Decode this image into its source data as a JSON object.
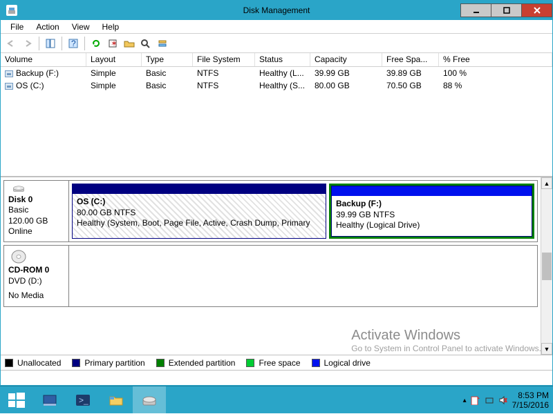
{
  "titlebar": {
    "title": "Disk Management"
  },
  "menu": {
    "file": "File",
    "action": "Action",
    "view": "View",
    "help": "Help"
  },
  "columns": {
    "volume": "Volume",
    "layout": "Layout",
    "type": "Type",
    "fs": "File System",
    "status": "Status",
    "capacity": "Capacity",
    "free": "Free Spa...",
    "pct": "% Free"
  },
  "volumes": [
    {
      "name": "Backup (F:)",
      "layout": "Simple",
      "type": "Basic",
      "fs": "NTFS",
      "status": "Healthy (L...",
      "capacity": "39.99 GB",
      "free": "39.89 GB",
      "pct": "100 %"
    },
    {
      "name": "OS (C:)",
      "layout": "Simple",
      "type": "Basic",
      "fs": "NTFS",
      "status": "Healthy (S...",
      "capacity": "80.00 GB",
      "free": "70.50 GB",
      "pct": "88 %"
    }
  ],
  "disks": {
    "disk0": {
      "title": "Disk 0",
      "type": "Basic",
      "size": "120.00 GB",
      "state": "Online"
    },
    "cdrom": {
      "title": "CD-ROM 0",
      "type": "DVD (D:)",
      "nomedia": "No Media"
    }
  },
  "partitions": {
    "os": {
      "name": "OS  (C:)",
      "size": "80.00 GB NTFS",
      "status": "Healthy (System, Boot, Page File, Active, Crash Dump, Primary"
    },
    "backup": {
      "name": "Backup  (F:)",
      "size": "39.99 GB NTFS",
      "status": "Healthy (Logical Drive)"
    }
  },
  "legend": {
    "unalloc": "Unallocated",
    "primary": "Primary partition",
    "extended": "Extended partition",
    "free": "Free space",
    "logical": "Logical drive"
  },
  "legend_colors": {
    "unalloc": "#000000",
    "primary": "#000080",
    "extended": "#008000",
    "free": "#00cc33",
    "logical": "#0011ee"
  },
  "watermark": {
    "line1": "Activate Windows",
    "line2": "Go to System in Control Panel to activate Windows."
  },
  "clock": {
    "time": "8:53 PM",
    "date": "7/15/2016"
  }
}
